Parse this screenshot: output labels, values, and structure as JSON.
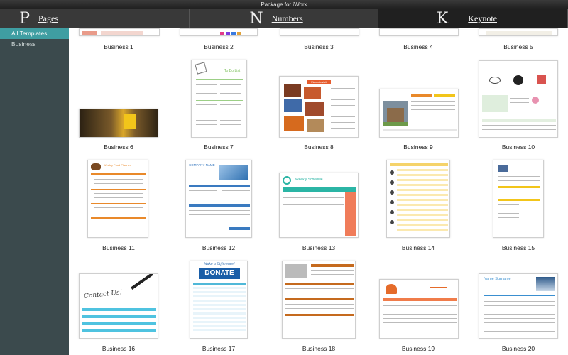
{
  "window": {
    "title": "Package for iWork"
  },
  "apps": [
    {
      "letter": "P",
      "label": "Pages"
    },
    {
      "letter": "N",
      "label": "Numbers"
    },
    {
      "letter": "K",
      "label": "Keynote"
    }
  ],
  "sidebar": {
    "items": [
      {
        "label": "All Templates",
        "selected": true
      },
      {
        "label": "Business",
        "selected": false
      }
    ]
  },
  "templates": [
    {
      "label": "Business 1"
    },
    {
      "label": "Business 2"
    },
    {
      "label": "Business 3"
    },
    {
      "label": "Business 4"
    },
    {
      "label": "Business 5"
    },
    {
      "label": "Business 6"
    },
    {
      "label": "Business 7"
    },
    {
      "label": "Business 8"
    },
    {
      "label": "Business 9"
    },
    {
      "label": "Business 10"
    },
    {
      "label": "Business 11"
    },
    {
      "label": "Business 12"
    },
    {
      "label": "Business 13"
    },
    {
      "label": "Business 14"
    },
    {
      "label": "Business 15"
    },
    {
      "label": "Business 16"
    },
    {
      "label": "Business 17"
    },
    {
      "label": "Business 18"
    },
    {
      "label": "Business 19"
    },
    {
      "label": "Business 20"
    }
  ],
  "thumb_text": {
    "t7": "To Do List",
    "t8": "Places to visit",
    "t11": "Weekly Food Planner",
    "t12": "COMPANY NAME",
    "t13": "Weekly Schedule",
    "t16": "Contact Us!",
    "t17_top": "Make a Difference!",
    "t17": "DONATE",
    "t20": "Name Surname"
  }
}
